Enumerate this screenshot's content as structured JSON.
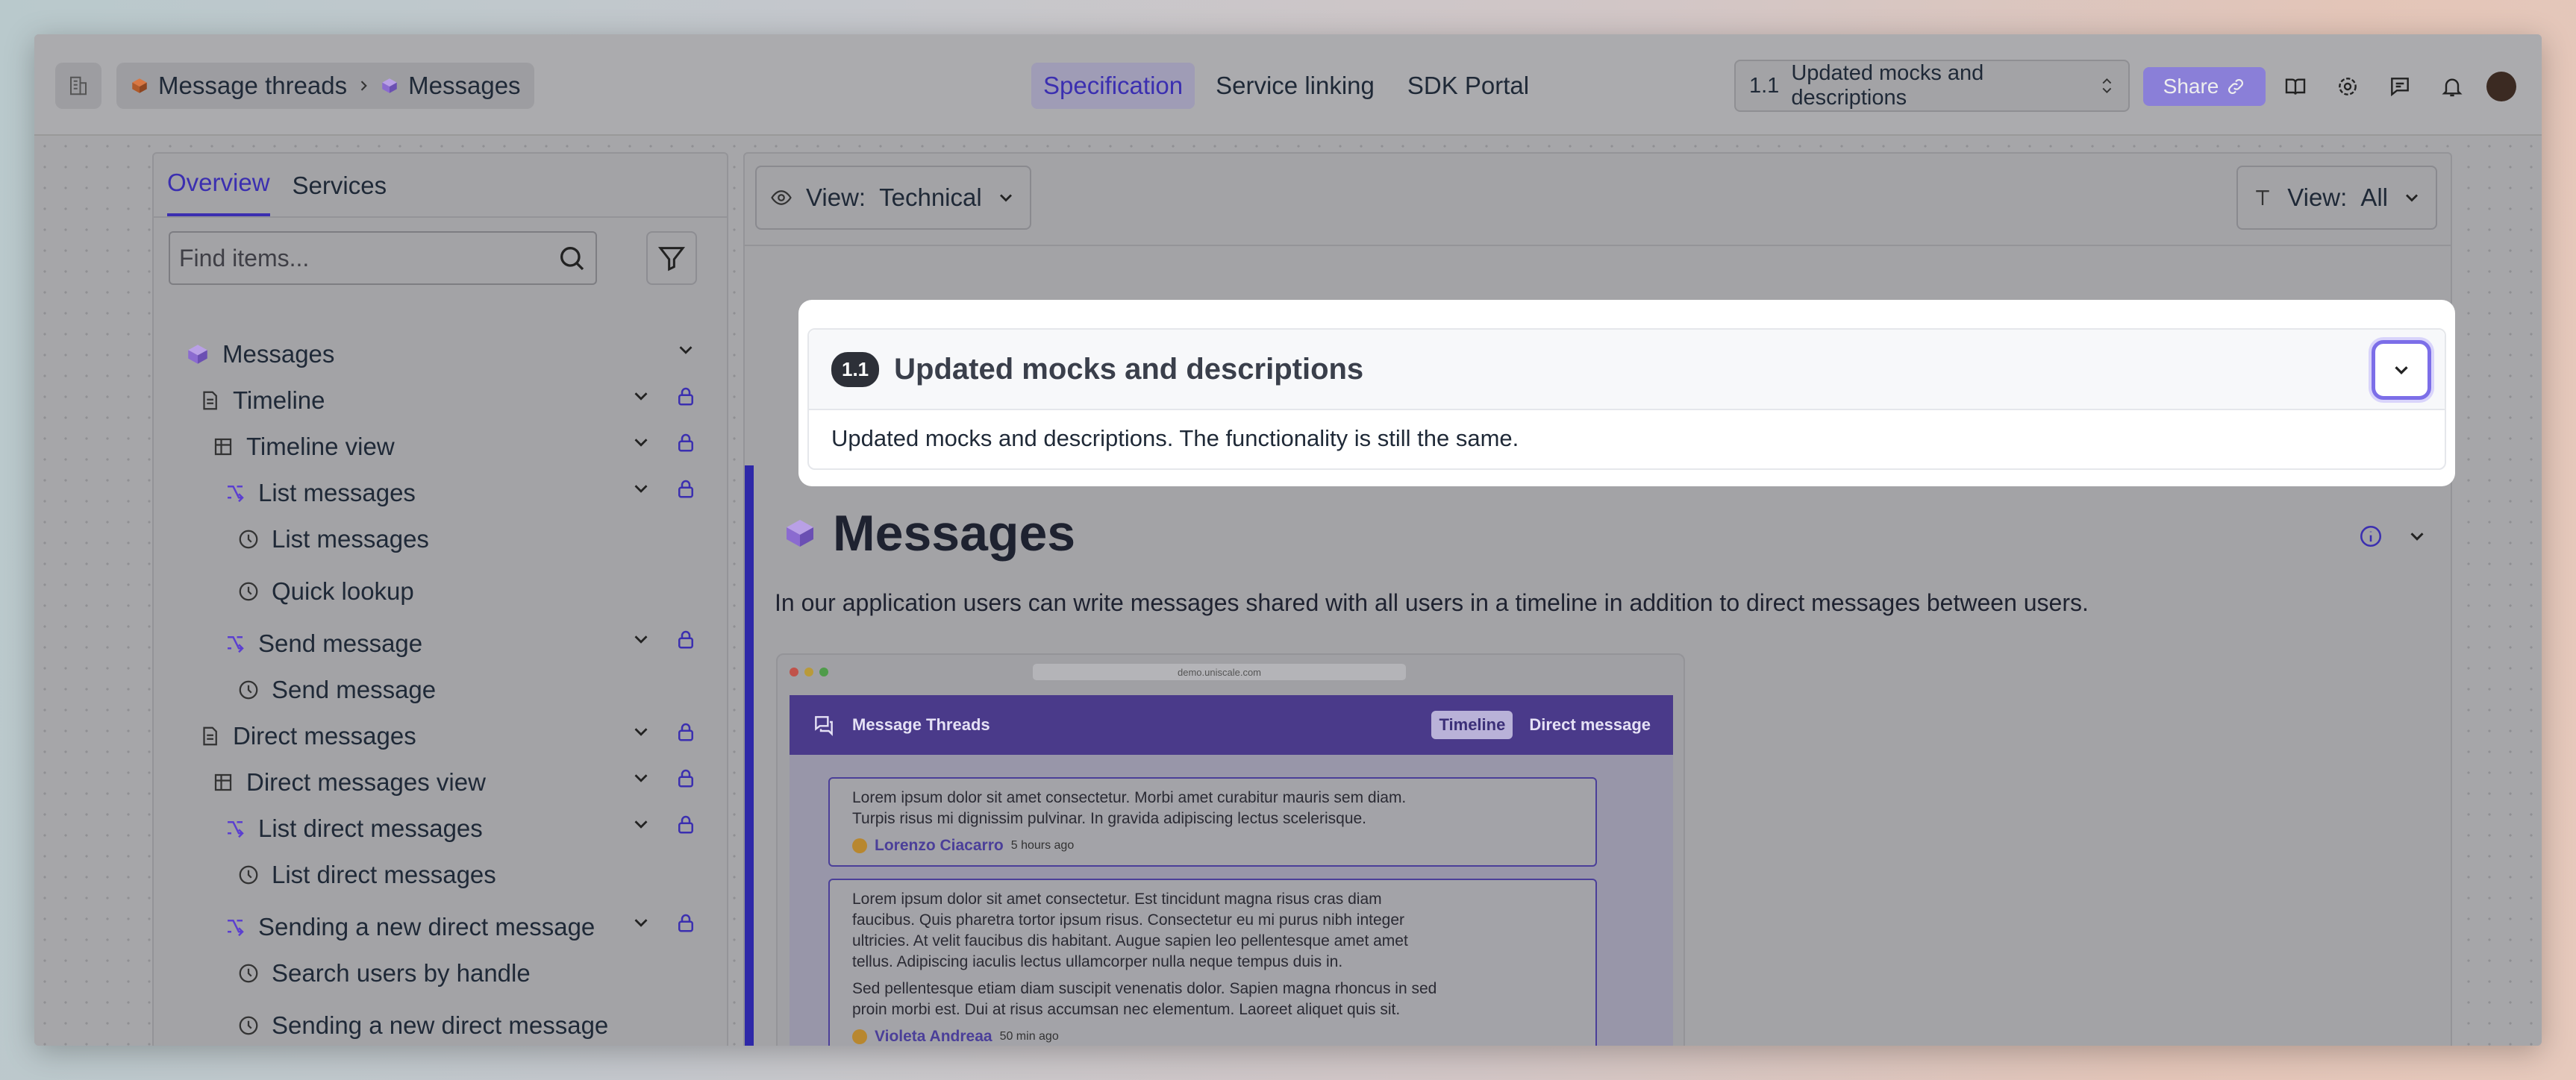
{
  "header": {
    "breadcrumb": [
      "Message threads",
      "Messages"
    ],
    "nav_tabs": [
      "Specification",
      "Service linking",
      "SDK Portal"
    ],
    "active_tab": "Specification",
    "version_number": "1.1",
    "version_label": "Updated mocks and descriptions",
    "share_label": "Share"
  },
  "sidebar": {
    "tabs": [
      "Overview",
      "Services"
    ],
    "search_placeholder": "Find items...",
    "tree": [
      {
        "label": "Messages",
        "icon": "cube-icon"
      },
      {
        "label": "Timeline",
        "icon": "document-icon"
      },
      {
        "label": "Timeline view",
        "icon": "table-icon"
      },
      {
        "label": "List messages",
        "icon": "flow-icon"
      },
      {
        "label": "List messages",
        "icon": "clock-icon"
      },
      {
        "label": "Quick lookup",
        "icon": "clock-icon"
      },
      {
        "label": "Send message",
        "icon": "flow-icon"
      },
      {
        "label": "Send message",
        "icon": "clock-icon"
      },
      {
        "label": "Direct messages",
        "icon": "document-icon"
      },
      {
        "label": "Direct messages view",
        "icon": "table-icon"
      },
      {
        "label": "List direct messages",
        "icon": "flow-icon"
      },
      {
        "label": "List direct messages",
        "icon": "clock-icon"
      },
      {
        "label": "Sending a new direct message",
        "icon": "flow-icon"
      },
      {
        "label": "Search users by handle",
        "icon": "clock-icon"
      },
      {
        "label": "Sending a new direct message",
        "icon": "clock-icon"
      }
    ]
  },
  "main": {
    "view_label": "View:",
    "view_value": "Technical",
    "view2_label": "View:",
    "view2_value": "All",
    "popover": {
      "badge": "1.1",
      "title": "Updated mocks and descriptions",
      "description": "Updated mocks and descriptions. The functionality is still the same."
    },
    "title": "Messages",
    "description": "In our application users can write messages shared with all users in a timeline in addition to direct messages between users.",
    "mock": {
      "url": "demo.uniscale.com",
      "app_title": "Message Threads",
      "tabs": [
        "Timeline",
        "Direct message"
      ],
      "messages": [
        {
          "lines": [
            "Lorem ipsum dolor sit amet consectetur. Morbi amet curabitur mauris sem diam.",
            "Turpis risus mi dignissim pulvinar. In gravida adipiscing lectus scelerisque."
          ],
          "author": "Lorenzo Ciacarro",
          "time": "5 hours ago"
        },
        {
          "lines": [
            "Lorem ipsum dolor sit amet consectetur. Est tincidunt magna risus cras diam",
            "faucibus. Quis pharetra tortor ipsum risus. Consectetur eu mi purus nibh integer",
            "ultricies. At velit faucibus dis habitant. Augue sapien leo pellentesque amet amet",
            "tellus. Adipiscing iaculis lectus ullamcorper nulla neque tempus duis in."
          ],
          "lines2": [
            "Sed pellentesque etiam diam suscipit venenatis dolor. Sapien magna rhoncus in sed",
            "proin morbi est. Dui at risus accumsan nec elementum. Laoreet aliquet quis sit."
          ],
          "author": "Violeta Andreaa",
          "time": "50 min ago"
        }
      ]
    }
  }
}
